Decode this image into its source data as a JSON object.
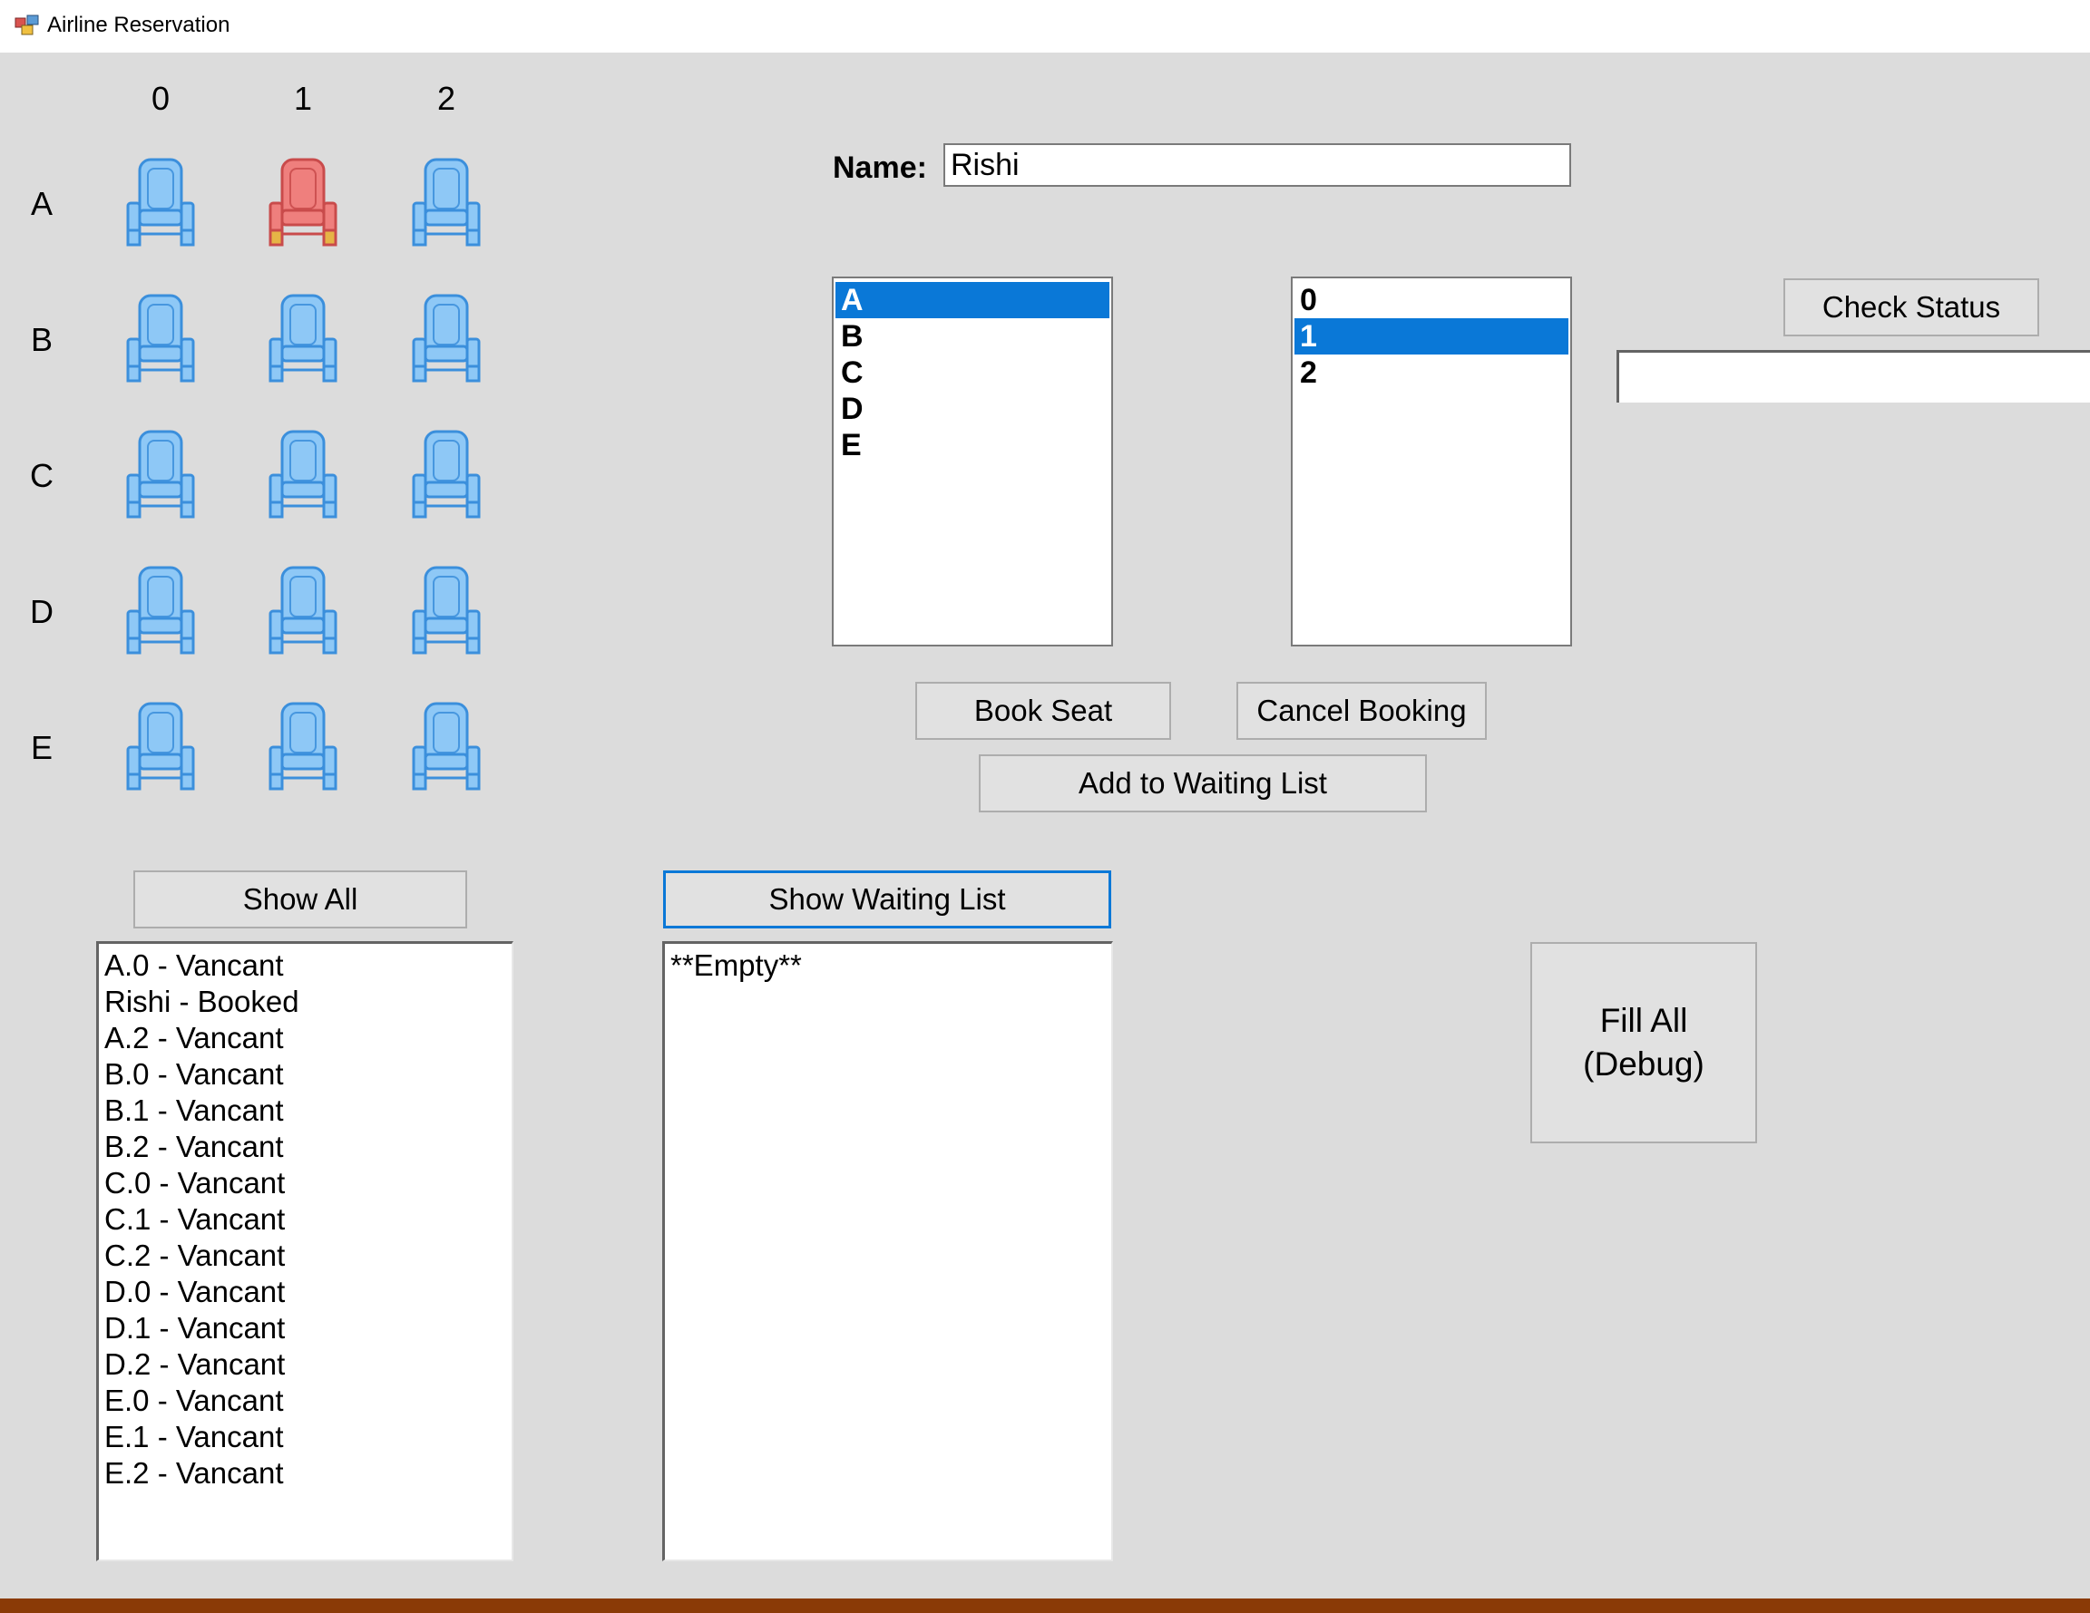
{
  "window": {
    "title": "Airline Reservation"
  },
  "seat_map": {
    "columns": [
      "0",
      "1",
      "2"
    ],
    "rows": [
      "A",
      "B",
      "C",
      "D",
      "E"
    ],
    "booked": [
      "A1"
    ],
    "colors": {
      "vacant": "#8ec8f6",
      "vacant_outline": "#3b8fdc",
      "booked": "#ef7f7d",
      "booked_outline": "#c94b4b",
      "booked_legs": "#e6b446"
    }
  },
  "form": {
    "name_label": "Name:",
    "name_value": "Rishi",
    "row_list": {
      "items": [
        "A",
        "B",
        "C",
        "D",
        "E"
      ],
      "selected": "A"
    },
    "col_list": {
      "items": [
        "0",
        "1",
        "2"
      ],
      "selected": "1"
    },
    "check_status_label": "Check Status",
    "status_value": "",
    "book_seat_label": "Book Seat",
    "cancel_booking_label": "Cancel Booking",
    "add_waiting_label": "Add to Waiting List"
  },
  "show_all": {
    "button_label": "Show All",
    "items": [
      "A.0 - Vancant",
      "Rishi - Booked",
      "A.2 - Vancant",
      "B.0 - Vancant",
      "B.1 - Vancant",
      "B.2 - Vancant",
      "C.0 - Vancant",
      "C.1 - Vancant",
      "C.2 - Vancant",
      "D.0 - Vancant",
      "D.1 - Vancant",
      "D.2 - Vancant",
      "E.0 - Vancant",
      "E.1 - Vancant",
      "E.2 - Vancant"
    ]
  },
  "waiting_list": {
    "button_label": "Show Waiting List",
    "items": [
      "**Empty**"
    ]
  },
  "debug": {
    "fill_all_line1": "Fill All",
    "fill_all_line2": "(Debug)"
  }
}
